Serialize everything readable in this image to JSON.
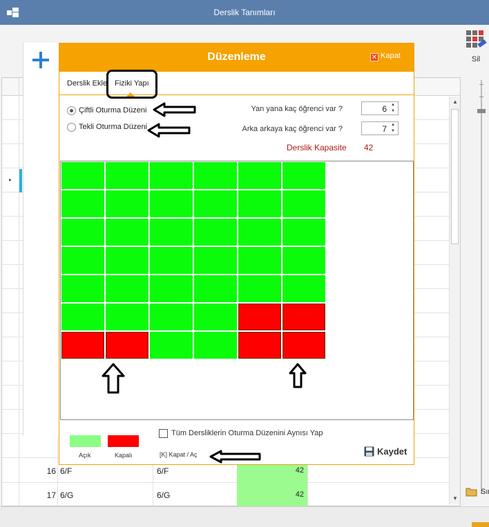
{
  "window": {
    "title": "Derslik Tanımları"
  },
  "toolbar": {
    "delete_label": "Sil"
  },
  "side": {
    "folder_label": "Sır"
  },
  "table": {
    "rows": [
      {
        "num": "16",
        "col1": "6/F",
        "col2": "6/F",
        "capacity": "42"
      },
      {
        "num": "17",
        "col1": "6/G",
        "col2": "6/G",
        "capacity": "42"
      }
    ]
  },
  "dialog": {
    "title": "Düzenleme",
    "close_label": "Kapat",
    "tabs": [
      {
        "label": "Derslik Ekle"
      },
      {
        "label": "Fiziki Yapı",
        "active": true
      }
    ],
    "layout_options": [
      {
        "label": "Çiftli Oturma Düzeni",
        "selected": true
      },
      {
        "label": "Tekli Oturma Düzeni",
        "selected": false
      }
    ],
    "side_by_side": {
      "label": "Yan yana kaç öğrenci var ?",
      "value": "6"
    },
    "front_to_back": {
      "label": "Arka arkaya kaç öğrenci var ?",
      "value": "7"
    },
    "capacity": {
      "label": "Derslik Kapasite",
      "value": "42"
    },
    "seat_grid": {
      "columns": 6,
      "rows": 7,
      "open_color": "#0bfc0b",
      "closed_color": "#ff0000",
      "seats": [
        [
          "open",
          "open",
          "open",
          "open",
          "open",
          "open"
        ],
        [
          "open",
          "open",
          "open",
          "open",
          "open",
          "open"
        ],
        [
          "open",
          "open",
          "open",
          "open",
          "open",
          "open"
        ],
        [
          "open",
          "open",
          "open",
          "open",
          "open",
          "open"
        ],
        [
          "open",
          "open",
          "open",
          "open",
          "open",
          "open"
        ],
        [
          "open",
          "open",
          "open",
          "open",
          "closed",
          "closed"
        ],
        [
          "closed",
          "closed",
          "open",
          "open",
          "closed",
          "closed"
        ]
      ]
    },
    "legend": {
      "open_label": "Açık",
      "closed_label": "Kapalı"
    },
    "same_layout_checkbox": {
      "label": "Tüm Dersliklerin Oturma Düzenini Aynısı Yap",
      "checked": false
    },
    "shortcut_hint": "[K] Kapat / Aç",
    "save_label": "Kaydet"
  }
}
